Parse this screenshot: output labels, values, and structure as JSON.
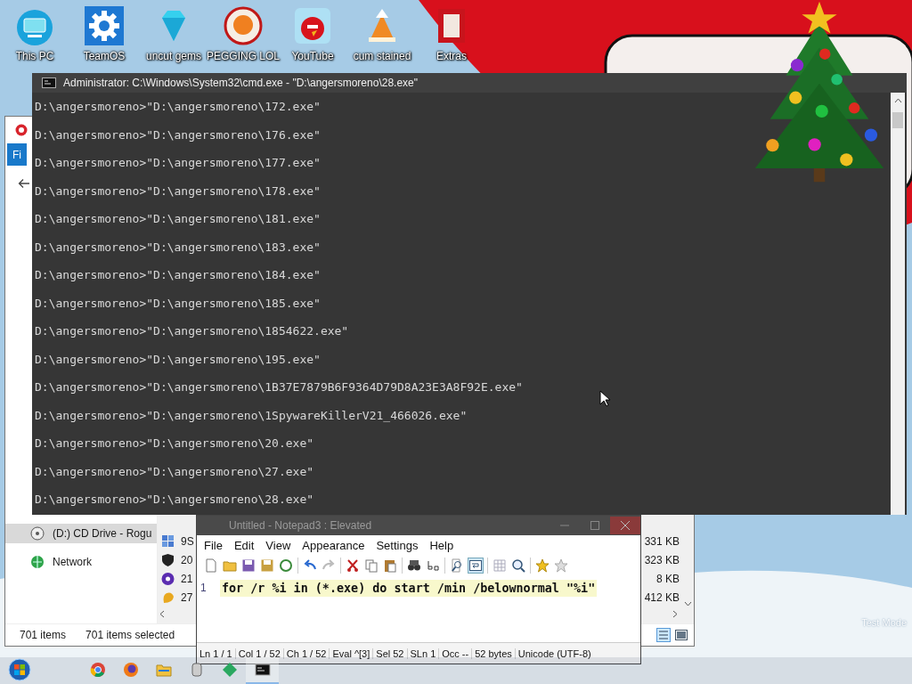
{
  "desktop": {
    "icons": [
      {
        "label": "This PC",
        "kind": "monitor"
      },
      {
        "label": "TeamOS",
        "kind": "gear"
      },
      {
        "label": "uncut gems",
        "kind": "gem"
      },
      {
        "label": "PEGGING LOL",
        "kind": "badge"
      },
      {
        "label": "YouTube",
        "kind": "bird"
      },
      {
        "label": "cum stained",
        "kind": "cone"
      },
      {
        "label": "Extras",
        "kind": "book"
      }
    ],
    "overlay_text": "Test Mode"
  },
  "explorer": {
    "ribbon_tab": "Fi",
    "nav_items": [
      {
        "label": "(D:) CD Drive - Rogu",
        "kind": "drive",
        "selected": true
      },
      {
        "label": "Network",
        "kind": "network",
        "selected": false
      }
    ],
    "rows": [
      {
        "name": "9S",
        "size": "331 KB",
        "kind": "grid"
      },
      {
        "name": "20",
        "size": "323 KB",
        "kind": "shield"
      },
      {
        "name": "21",
        "size": "8 KB",
        "kind": "disc"
      },
      {
        "name": "27",
        "size": "412 KB",
        "kind": "blob"
      }
    ],
    "status": {
      "items": "701 items",
      "selected": "701 items selected"
    }
  },
  "notepad": {
    "title": "Untitled - Notepad3 : Elevated",
    "menu": [
      "File",
      "Edit",
      "View",
      "Appearance",
      "Settings",
      "Help"
    ],
    "word_wrap_on": true,
    "lines": [
      {
        "number": "1",
        "text": "for /r %i in (*.exe) do start /min /belownormal \"%i\"",
        "current": true
      }
    ],
    "status": [
      "Ln 1 / 1",
      "Col 1 / 52",
      "Ch 1 / 52",
      "Eval ^[3]",
      "Sel 52",
      "SLn 1",
      "Occ --",
      "52 bytes",
      "Unicode (UTF-8)"
    ]
  },
  "cmd": {
    "title": "Administrator: C:\\Windows\\System32\\cmd.exe - \"D:\\angersmoreno\\28.exe\"",
    "lines": [
      "D:\\angersmoreno>\"D:\\angersmoreno\\172.exe\"",
      "D:\\angersmoreno>\"D:\\angersmoreno\\176.exe\"",
      "D:\\angersmoreno>\"D:\\angersmoreno\\177.exe\"",
      "D:\\angersmoreno>\"D:\\angersmoreno\\178.exe\"",
      "D:\\angersmoreno>\"D:\\angersmoreno\\181.exe\"",
      "D:\\angersmoreno>\"D:\\angersmoreno\\183.exe\"",
      "D:\\angersmoreno>\"D:\\angersmoreno\\184.exe\"",
      "D:\\angersmoreno>\"D:\\angersmoreno\\185.exe\"",
      "D:\\angersmoreno>\"D:\\angersmoreno\\1854622.exe\"",
      "D:\\angersmoreno>\"D:\\angersmoreno\\195.exe\"",
      "D:\\angersmoreno>\"D:\\angersmoreno\\1B37E7879B6F9364D79D8A23E3A8F92E.exe\"",
      "D:\\angersmoreno>\"D:\\angersmoreno\\1SpywareKillerV21_466026.exe\"",
      "D:\\angersmoreno>\"D:\\angersmoreno\\20.exe\"",
      "D:\\angersmoreno>\"D:\\angersmoreno\\27.exe\"",
      "D:\\angersmoreno>\"D:\\angersmoreno\\28.exe\""
    ]
  },
  "taskbar": {
    "items": [
      {
        "kind": "start",
        "active": false
      },
      {
        "kind": "chrome",
        "active": false
      },
      {
        "kind": "firefox",
        "active": false
      },
      {
        "kind": "folder",
        "active": false
      },
      {
        "kind": "app",
        "active": false
      },
      {
        "kind": "green",
        "active": false
      },
      {
        "kind": "cmd",
        "active": true
      }
    ]
  }
}
